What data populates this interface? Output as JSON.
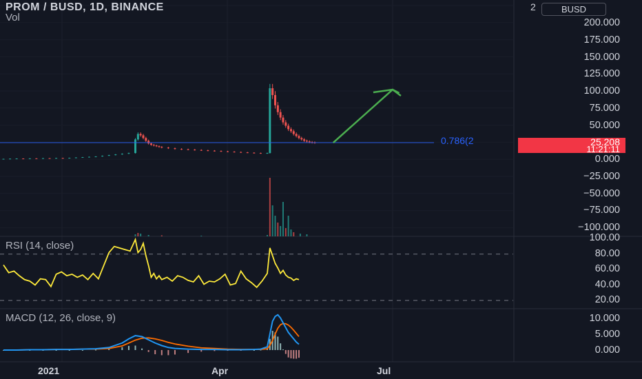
{
  "header": {
    "symbol_line": "PROM / BUSD, 1D, BINANCE",
    "volume_label": "Vol"
  },
  "price_axis": {
    "currency_badge": "BUSD",
    "scale_marker": "2",
    "ticks": [
      "200.000",
      "175.000",
      "150.000",
      "125.000",
      "100.000",
      "75.000",
      "50.000",
      "0.000",
      "−25.000",
      "−50.000",
      "−75.000",
      "−100.000"
    ]
  },
  "current_price": {
    "value": "25.208",
    "countdown": "11:21:11"
  },
  "fib_label": "0.786(2",
  "time_axis": [
    "2021",
    "Apr",
    "Jul"
  ],
  "rsi_panel": {
    "label": "RSI (14, close)",
    "ticks": [
      "100.00",
      "80.00",
      "60.00",
      "40.00",
      "20.00"
    ]
  },
  "macd_panel": {
    "label": "MACD (12, 26, close, 9)",
    "ticks": [
      "10.000",
      "5.000",
      "0.000"
    ]
  },
  "colors": {
    "background": "#131722",
    "up": "#26a69a",
    "down": "#ef5350",
    "rsi": "#ffeb3b",
    "macd": "#2196f3",
    "signal": "#ff6d00",
    "arrow": "#4caf50",
    "fib": "#2962ff"
  },
  "chart_data": [
    {
      "type": "line",
      "panel": "price",
      "ylim": [
        -100,
        210
      ],
      "x": [
        0,
        5,
        10,
        15,
        20,
        25,
        30,
        35,
        40,
        45,
        50,
        55,
        60,
        65,
        70,
        75,
        80,
        85,
        90,
        95,
        100,
        102,
        104,
        106,
        108,
        110,
        112,
        114,
        116,
        118,
        120,
        125,
        130,
        135,
        140,
        145,
        150,
        155,
        160,
        165,
        170,
        175,
        180,
        185,
        190,
        195,
        200,
        202,
        204,
        206,
        208,
        210,
        212,
        214,
        216,
        218,
        220,
        222,
        224,
        226,
        228,
        230,
        232,
        234,
        236
      ],
      "close": [
        1.5,
        1.8,
        2,
        1.6,
        2.2,
        1.9,
        2.5,
        2.2,
        2.8,
        2.5,
        3,
        3.5,
        4,
        4.5,
        5,
        6,
        7,
        8,
        9,
        10,
        30,
        38,
        36,
        32,
        28,
        24,
        22,
        21,
        20,
        19,
        18,
        17,
        16,
        15.5,
        15,
        14.5,
        14,
        13.5,
        13,
        12.5,
        12,
        11.5,
        11,
        10.5,
        10,
        9.5,
        10,
        105,
        95,
        80,
        70,
        62,
        55,
        50,
        45,
        42,
        38,
        35,
        32,
        30,
        28,
        27,
        26,
        25.5,
        25.208
      ],
      "current": 25.208,
      "projection": {
        "x": [
          250,
          295,
          300
        ],
        "y": [
          25.208,
          103,
          98
        ]
      }
    },
    {
      "type": "bar",
      "panel": "volume",
      "x": [
        100,
        102,
        104,
        110,
        120,
        150,
        200,
        202,
        204,
        206,
        208,
        210,
        212,
        214,
        216,
        218,
        220,
        225,
        230
      ],
      "values": [
        3,
        5,
        4,
        2,
        1.5,
        1,
        2,
        85,
        45,
        30,
        20,
        15,
        50,
        12,
        30,
        10,
        6,
        4,
        3
      ]
    },
    {
      "type": "line",
      "panel": "rsi",
      "ylim": [
        10,
        105
      ],
      "levels": [
        80,
        20
      ],
      "x": [
        0,
        4,
        8,
        12,
        16,
        20,
        24,
        28,
        32,
        36,
        40,
        44,
        48,
        52,
        56,
        60,
        64,
        68,
        72,
        76,
        80,
        84,
        88,
        92,
        96,
        100,
        102,
        104,
        106,
        108,
        110,
        112,
        114,
        116,
        118,
        120,
        124,
        128,
        132,
        136,
        140,
        144,
        148,
        152,
        156,
        160,
        164,
        168,
        172,
        176,
        180,
        184,
        188,
        192,
        196,
        200,
        202,
        204,
        206,
        208,
        210,
        212,
        214,
        216,
        218,
        220,
        222,
        224
      ],
      "values": [
        66,
        56,
        58,
        52,
        47,
        45,
        40,
        48,
        47,
        38,
        54,
        57,
        52,
        54,
        50,
        53,
        47,
        55,
        48,
        65,
        82,
        90,
        88,
        86,
        84,
        99,
        82,
        86,
        94,
        78,
        65,
        50,
        55,
        48,
        52,
        47,
        50,
        45,
        52,
        50,
        46,
        44,
        52,
        41,
        45,
        44,
        48,
        54,
        40,
        42,
        58,
        48,
        43,
        37,
        45,
        55,
        88,
        78,
        68,
        62,
        55,
        59,
        53,
        50,
        49,
        46,
        48,
        47
      ]
    },
    {
      "type": "line",
      "panel": "macd",
      "ylim": [
        -3,
        13
      ],
      "x": [
        0,
        10,
        20,
        30,
        40,
        50,
        60,
        70,
        80,
        90,
        95,
        100,
        105,
        110,
        115,
        120,
        125,
        130,
        140,
        150,
        160,
        170,
        180,
        190,
        195,
        200,
        202,
        204,
        206,
        208,
        210,
        212,
        214,
        216,
        218,
        220,
        222,
        224
      ],
      "series": [
        {
          "name": "MACD",
          "values": [
            0,
            0,
            0.1,
            0.1,
            0.2,
            0.2,
            0.3,
            0.4,
            0.8,
            2.2,
            3.5,
            4.5,
            4.2,
            3.2,
            2.2,
            1.4,
            0.8,
            0.5,
            0.3,
            0.2,
            0.2,
            0.1,
            0.1,
            0.2,
            0.3,
            1.0,
            5.0,
            9.0,
            10.5,
            11.0,
            10.0,
            8.5,
            7.0,
            5.5,
            4.5,
            3.5,
            2.5,
            1.8
          ]
        },
        {
          "name": "Signal",
          "values": [
            0,
            0,
            0.1,
            0.1,
            0.2,
            0.2,
            0.3,
            0.3,
            0.5,
            1.3,
            2.2,
            3.1,
            3.7,
            3.8,
            3.5,
            3.0,
            2.4,
            1.9,
            1.2,
            0.7,
            0.5,
            0.3,
            0.2,
            0.2,
            0.2,
            0.4,
            1.5,
            3.0,
            5.0,
            6.8,
            7.9,
            8.3,
            8.2,
            7.8,
            7.1,
            6.2,
            5.2,
            4.2
          ]
        }
      ]
    }
  ]
}
